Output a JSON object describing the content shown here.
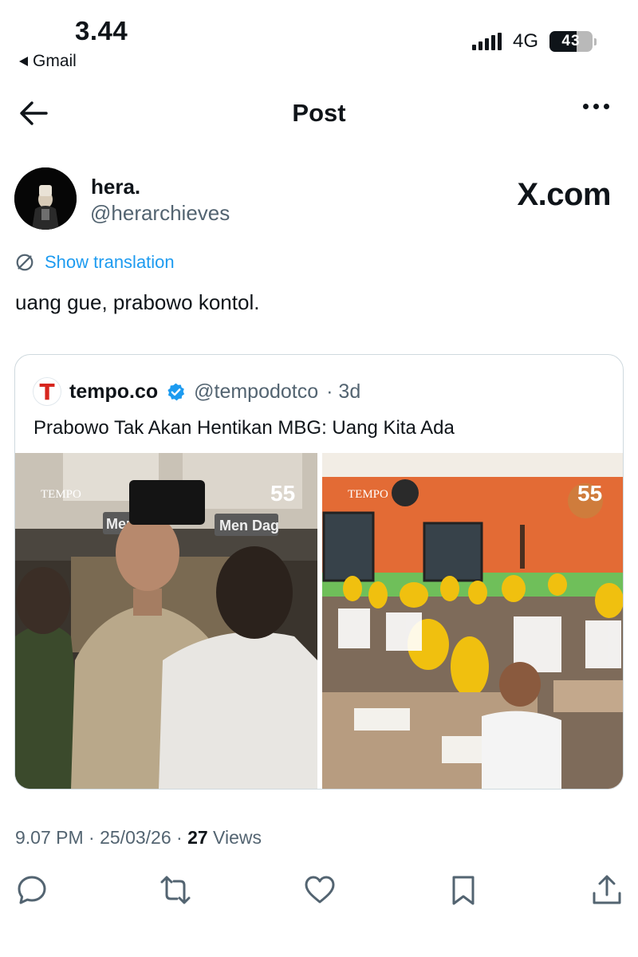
{
  "status_bar": {
    "time": "3.44",
    "back_app": "Gmail",
    "network": "4G",
    "battery": "43"
  },
  "header": {
    "title": "Post"
  },
  "tweet": {
    "author_name": "hera.",
    "author_handle": "@herarchieves",
    "watermark": "X.com",
    "translate_label": "Show translation",
    "text": "uang gue, prabowo kontol.",
    "timestamp": "9.07 PM · 25/03/26 · ",
    "views_count": "27",
    "views_label": " Views"
  },
  "quote": {
    "logo_letter": "T",
    "name": "tempo.co",
    "handle": "@tempodotco",
    "age": "· 3d",
    "title": "Prabowo Tak Akan Hentikan MBG: Uang Kita Ada",
    "images": [
      {
        "watermark": "TEMPO",
        "badge": "55",
        "placards": [
          "Men",
          "Men Dag"
        ]
      },
      {
        "watermark": "TEMPO",
        "badge": "55"
      }
    ]
  },
  "icons": {
    "back": "arrow-left-icon",
    "more": "more-horizontal-icon",
    "translate": "translate-icon",
    "verified": "verified-badge-icon",
    "reply": "reply-icon",
    "repost": "repost-icon",
    "like": "heart-icon",
    "bookmark": "bookmark-icon",
    "share": "share-icon"
  },
  "colors": {
    "accent": "#1d9bf0",
    "secondary_text": "#536471",
    "tempo_red": "#d7261e"
  }
}
